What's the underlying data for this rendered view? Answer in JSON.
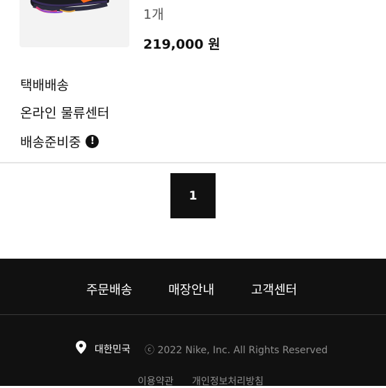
{
  "order_item": {
    "quantity": "1개",
    "price": "219,000 원"
  },
  "shipping": {
    "method": "택배배송",
    "center": "온라인 물류센터",
    "status": "배송준비중",
    "status_icon": "exclamation-icon",
    "status_icon_glyph": "!"
  },
  "pagination": {
    "current_page": "1"
  },
  "footer": {
    "links": [
      "주문배송",
      "매장안내",
      "고객센터"
    ],
    "country": "대한민국",
    "location_icon": "map-pin-icon",
    "copyright": "ⓒ 2022 Nike, Inc. All Rights Reserved",
    "legal_links": [
      "이용약관",
      "개인정보처리방침"
    ]
  },
  "colors": {
    "background": "#ffffff",
    "footer_background": "#111111",
    "pagination_active": "#111111",
    "muted_text": "#8d8d8d"
  }
}
